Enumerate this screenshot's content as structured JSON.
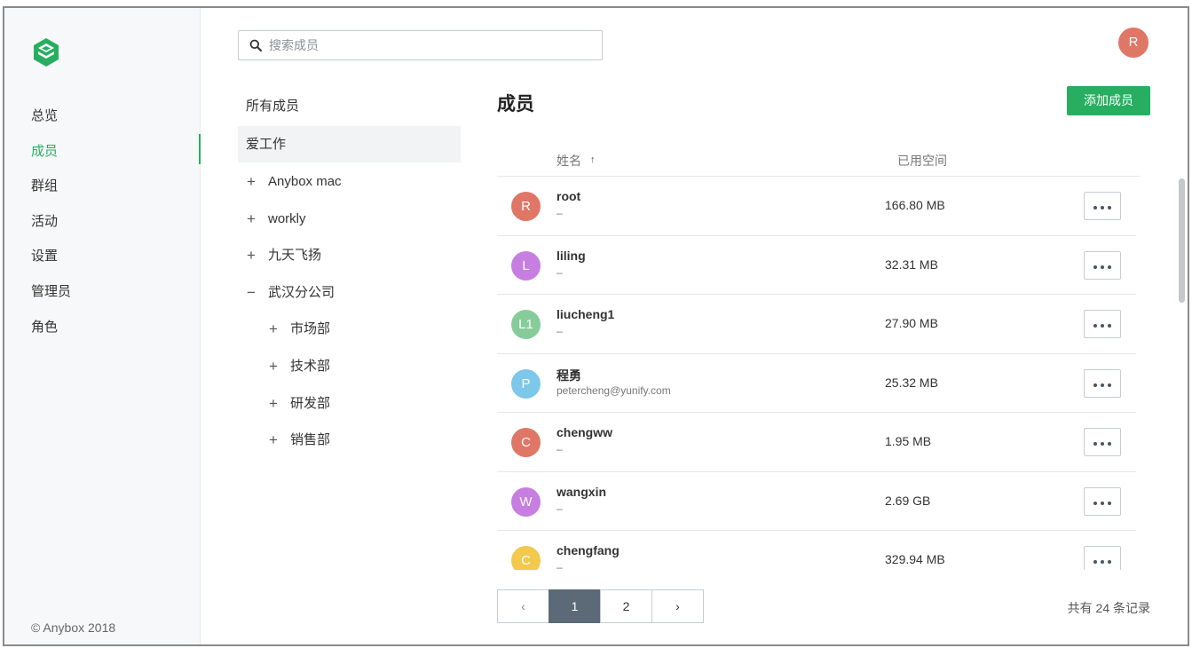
{
  "nav": {
    "items": [
      {
        "label": "总览",
        "active": false
      },
      {
        "label": "成员",
        "active": true
      },
      {
        "label": "群组",
        "active": false
      },
      {
        "label": "活动",
        "active": false
      },
      {
        "label": "设置",
        "active": false
      },
      {
        "label": "管理员",
        "active": false
      },
      {
        "label": "角色",
        "active": false
      }
    ],
    "copyright": "© Anybox 2018",
    "accent": "#27ae60"
  },
  "search": {
    "placeholder": "搜索成员",
    "value": ""
  },
  "user": {
    "avatar_letter": "R",
    "color": "#e07666"
  },
  "tree": {
    "all_members": "所有成员",
    "root": "爱工作",
    "nodes": [
      {
        "label": "Anybox mac",
        "toggle": "+",
        "level": 1
      },
      {
        "label": "workly",
        "toggle": "+",
        "level": 1
      },
      {
        "label": "九天飞扬",
        "toggle": "+",
        "level": 1
      },
      {
        "label": "武汉分公司",
        "toggle": "−",
        "level": 1
      },
      {
        "label": "市场部",
        "toggle": "+",
        "level": 2
      },
      {
        "label": "技术部",
        "toggle": "+",
        "level": 2
      },
      {
        "label": "研发部",
        "toggle": "+",
        "level": 2
      },
      {
        "label": "销售部",
        "toggle": "+",
        "level": 2
      }
    ]
  },
  "main": {
    "title": "成员",
    "add_button": "添加成员",
    "columns": {
      "name": "姓名",
      "sort_icon": "↑",
      "space": "已用空间"
    },
    "members": [
      {
        "initial": "R",
        "color": "#e07666",
        "name": "root",
        "email": "–",
        "space": "166.80 MB"
      },
      {
        "initial": "L",
        "color": "#c67ee0",
        "name": "liling",
        "email": "–",
        "space": "32.31 MB"
      },
      {
        "initial": "L1",
        "color": "#86cc9a",
        "name": "liucheng1",
        "email": "–",
        "space": "27.90 MB"
      },
      {
        "initial": "P",
        "color": "#7cc7ea",
        "name": "程勇",
        "email": "petercheng@yunify.com",
        "space": "25.32 MB"
      },
      {
        "initial": "C",
        "color": "#e07666",
        "name": "chengww",
        "email": "–",
        "space": "1.95 MB"
      },
      {
        "initial": "W",
        "color": "#c67ee0",
        "name": "wangxin",
        "email": "–",
        "space": "2.69 GB"
      },
      {
        "initial": "C",
        "color": "#f2c94c",
        "name": "chengfang",
        "email": "–",
        "space": "329.94 MB"
      }
    ]
  },
  "pagination": {
    "prev": "‹",
    "pages": [
      "1",
      "2"
    ],
    "current": "1",
    "next": "›",
    "total": "共有 24 条记录"
  }
}
